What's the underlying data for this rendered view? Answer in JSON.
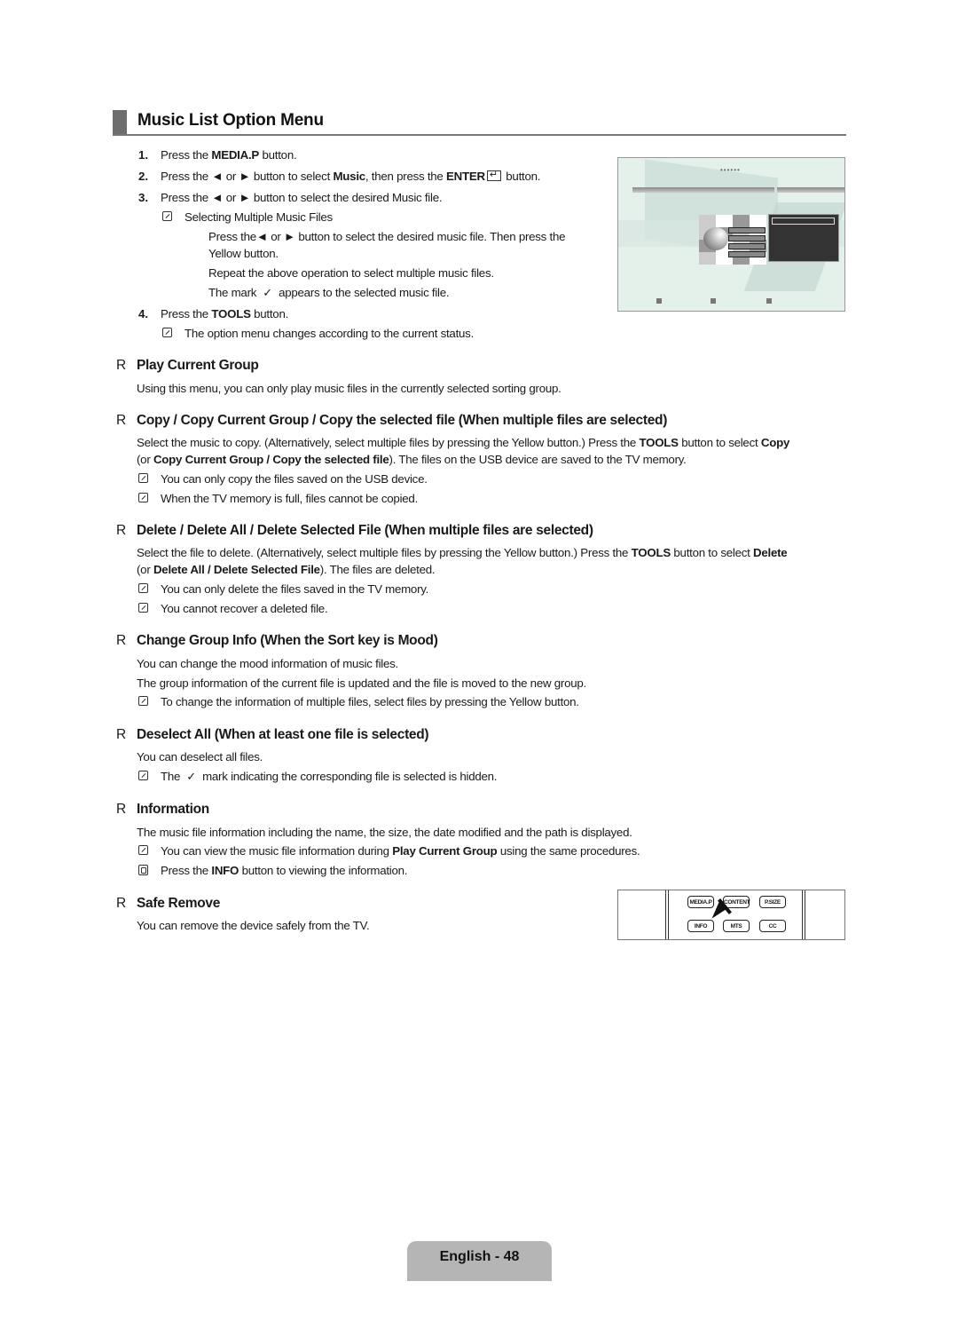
{
  "page": {
    "title": "Music List Option Menu",
    "footer": "English - 48"
  },
  "steps": [
    {
      "num": "1.",
      "pre": "Press the ",
      "bold": "MEDIA.P",
      "post": " button."
    },
    {
      "num": "2.",
      "pre": "Press the ◄ or ► button to select ",
      "bold": "Music",
      "mid": ", then press the ",
      "bold2": "ENTER",
      "post": " button."
    },
    {
      "num": "3.",
      "text": "Press the ◄ or ► button to select the desired Music file."
    },
    {
      "num": "4.",
      "pre": "Press the ",
      "bold": "TOOLS",
      "post": " button."
    }
  ],
  "step3_note": {
    "title": "Selecting Multiple Music Files",
    "line1": "Press the◄ or ► button to select the desired music file. Then press the",
    "line2": "Yellow button.",
    "line3": "Repeat the above operation to select multiple music files.",
    "line4_pre": "The mark",
    "line4_post": "appears to the selected music file."
  },
  "step4_note": "The option menu changes according to the current status.",
  "bullet": "R",
  "check_glyph": "✓",
  "sections": {
    "play": {
      "heading": "Play Current Group",
      "body": "Using this menu, you can only play music files in the currently selected sorting group."
    },
    "copy": {
      "heading": "Copy / Copy Current Group / Copy the selected file (When multiple files are selected)",
      "body1_pre": "Select the music to copy. (Alternatively, select multiple files by pressing the Yellow button.) Press the ",
      "body1_b1": "TOOLS",
      "body1_mid": " button to select ",
      "body1_b2": "Copy",
      "body2_pre": "(or ",
      "body2_b": "Copy Current Group / Copy the selected file",
      "body2_post": "). The files on the USB device are saved to the TV memory.",
      "notes": [
        "You can only copy the files saved on the USB device.",
        "When the TV memory is full, files cannot be copied."
      ]
    },
    "delete": {
      "heading": "Delete / Delete All / Delete Selected File (When multiple files are selected)",
      "body1_pre": "Select the file to delete. (Alternatively, select multiple files by pressing the Yellow button.) Press the ",
      "body1_b1": "TOOLS",
      "body1_mid": " button to select ",
      "body1_b2": "Delete",
      "body2_pre": "(or ",
      "body2_b": "Delete All / Delete Selected File",
      "body2_post": "). The files are deleted.",
      "notes": [
        "You can only delete the files saved in the TV memory.",
        "You cannot recover a deleted file."
      ]
    },
    "group": {
      "heading": "Change Group Info (When the Sort key is Mood)",
      "body1": "You can change the mood information of music files.",
      "body2": "The group information of the current file is updated and the file is moved to the new group.",
      "note": "To change the information of multiple files, select files by pressing the Yellow button."
    },
    "deselect": {
      "heading": "Deselect All (When at least one file is selected)",
      "body": "You can deselect all files.",
      "note_pre": "The",
      "note_post": "mark indicating the corresponding file is selected is hidden."
    },
    "info": {
      "heading": "Information",
      "body": "The music file information including the name, the size, the date modified and the path is displayed.",
      "note_pre": "You can view the music file information during ",
      "note_b": "Play Current Group",
      "note_post": " using the same procedures.",
      "remote_pre": "Press the ",
      "remote_b": "INFO",
      "remote_post": " button to viewing the information."
    },
    "safe": {
      "heading": "Safe Remove",
      "body": "You can remove the device safely from the TV."
    }
  },
  "remote": {
    "buttons": [
      "MEDIA.P",
      "CONTENT",
      "P.SIZE",
      "INFO",
      "MTS",
      "CC"
    ]
  }
}
